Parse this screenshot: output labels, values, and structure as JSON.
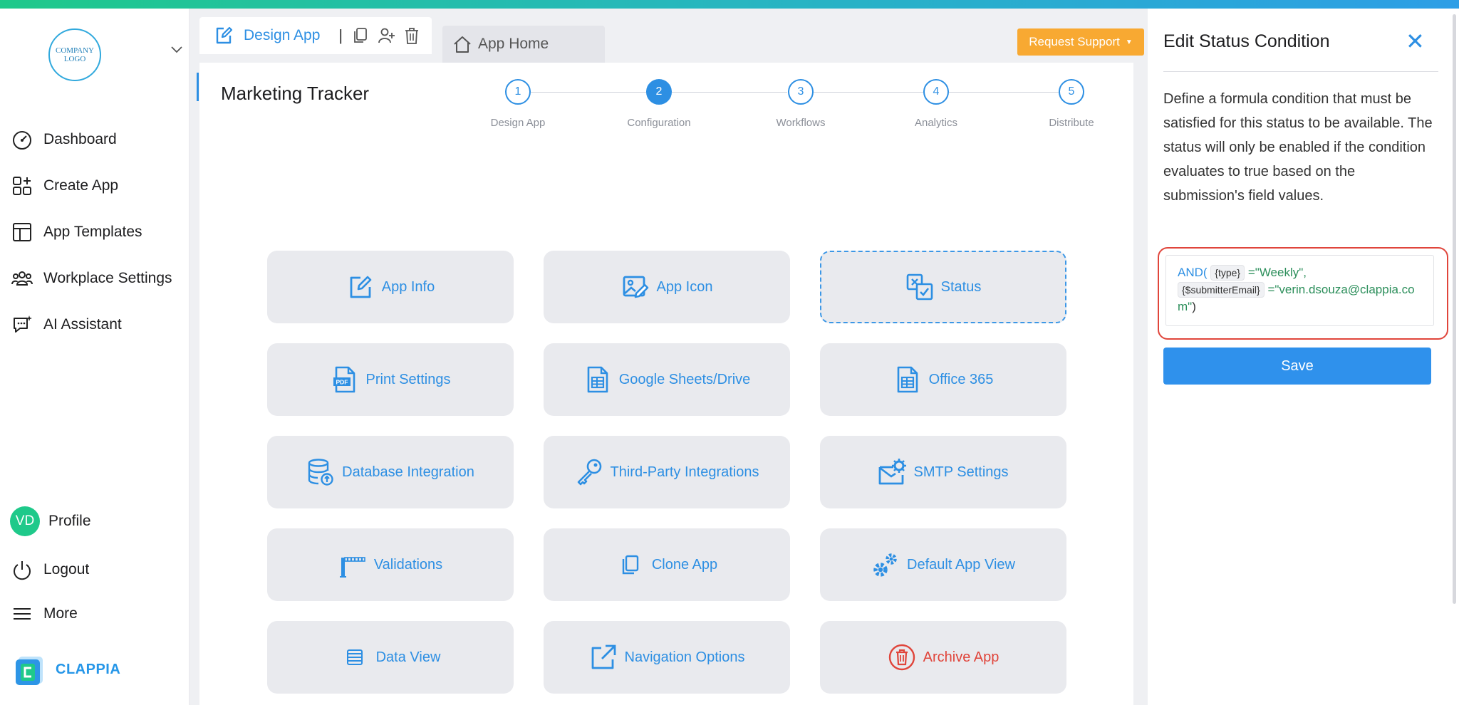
{
  "colors": {
    "accent": "#2d8fe3",
    "danger": "#e0453b",
    "support": "#f8a932",
    "avatar": "#1fc98a"
  },
  "logo": {
    "text": "COMPANY LOGO"
  },
  "sidebar": {
    "items": [
      {
        "label": "Dashboard",
        "icon": "gauge-icon"
      },
      {
        "label": "Create App",
        "icon": "create-app-icon"
      },
      {
        "label": "App Templates",
        "icon": "templates-icon"
      },
      {
        "label": "Workplace Settings",
        "icon": "users-icon"
      },
      {
        "label": "AI Assistant",
        "icon": "ai-chat-icon"
      }
    ],
    "profile": {
      "initials": "VD",
      "label": "Profile"
    },
    "logout": "Logout",
    "more": "More",
    "brand": "CLAPPIA"
  },
  "tabs": {
    "design_app": "Design App",
    "separator": "|",
    "app_home": "App Home"
  },
  "header": {
    "request_support": "Request Support",
    "app_name": "Marketing Tracker"
  },
  "steps": [
    {
      "num": "1",
      "label": "Design App",
      "active": false
    },
    {
      "num": "2",
      "label": "Configuration",
      "active": true
    },
    {
      "num": "3",
      "label": "Workflows",
      "active": false
    },
    {
      "num": "4",
      "label": "Analytics",
      "active": false
    },
    {
      "num": "5",
      "label": "Distribute",
      "active": false
    }
  ],
  "tiles": [
    {
      "label": "App Info",
      "icon": "edit-icon"
    },
    {
      "label": "App Icon",
      "icon": "image-edit-icon"
    },
    {
      "label": "Status",
      "icon": "status-icon",
      "selected": true
    },
    {
      "label": "Print Settings",
      "icon": "pdf-icon"
    },
    {
      "label": "Google Sheets/Drive",
      "icon": "sheet-icon"
    },
    {
      "label": "Office 365",
      "icon": "sheet-icon"
    },
    {
      "label": "Database Integration",
      "icon": "database-icon"
    },
    {
      "label": "Third-Party Integrations",
      "icon": "key-icon"
    },
    {
      "label": "SMTP Settings",
      "icon": "mail-gear-icon"
    },
    {
      "label": "Validations",
      "icon": "barrier-icon"
    },
    {
      "label": "Clone App",
      "icon": "copy-icon"
    },
    {
      "label": "Default App View",
      "icon": "gears-icon"
    },
    {
      "label": "Data View",
      "icon": "list-icon"
    },
    {
      "label": "Navigation Options",
      "icon": "external-link-icon"
    },
    {
      "label": "Archive App",
      "icon": "archive-icon",
      "danger": true
    }
  ],
  "panel": {
    "title": "Edit Status Condition",
    "close": "✕",
    "description": "Define a formula condition that must be satisfied for this status to be available. The status will only be enabled if the condition evaluates to true based on the submission's field values.",
    "formula": {
      "fn": "AND(",
      "field1": "{type}",
      "eq1": " =",
      "val1": "\"Weekly\",",
      "field2": "{$submitterEmail}",
      "eq2": " =",
      "val2": "\"verin.dsouza@clappia.com\"",
      "close": ")"
    },
    "save": "Save"
  }
}
